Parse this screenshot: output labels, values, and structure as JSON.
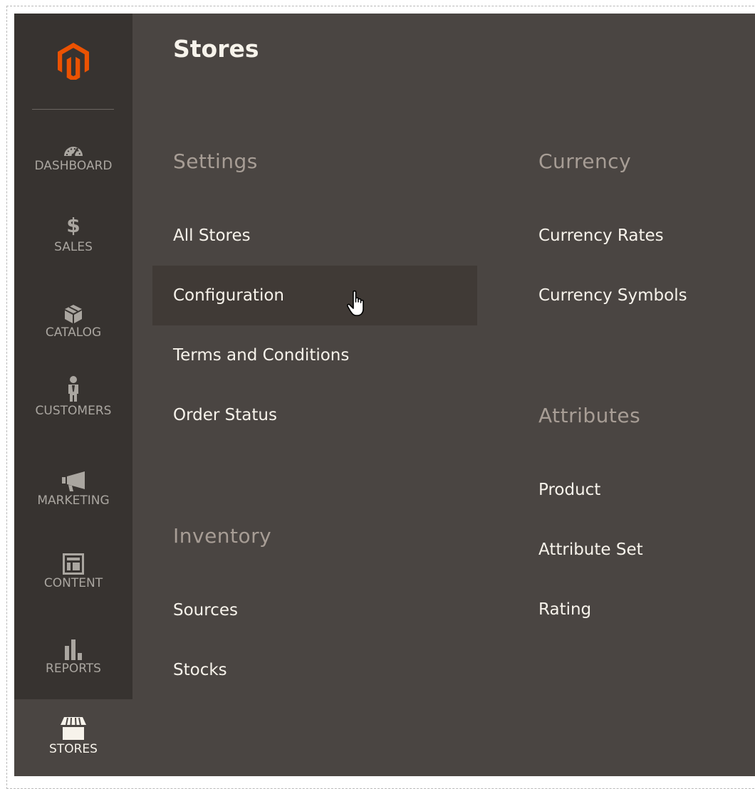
{
  "sidebar": {
    "logo": "magento-logo",
    "items": [
      {
        "label": "DASHBOARD",
        "icon": "dashboard-gauge-icon"
      },
      {
        "label": "SALES",
        "icon": "dollar-icon",
        "glyph": "$"
      },
      {
        "label": "CATALOG",
        "icon": "box-icon"
      },
      {
        "label": "CUSTOMERS",
        "icon": "person-icon"
      },
      {
        "label": "MARKETING",
        "icon": "megaphone-icon"
      },
      {
        "label": "CONTENT",
        "icon": "layout-icon"
      },
      {
        "label": "REPORTS",
        "icon": "bar-chart-icon"
      },
      {
        "label": "STORES",
        "icon": "storefront-icon",
        "active": true
      }
    ]
  },
  "panel": {
    "title": "Stores",
    "settings": {
      "title": "Settings",
      "links": [
        "All Stores",
        "Configuration",
        "Terms and Conditions",
        "Order Status"
      ]
    },
    "inventory": {
      "title": "Inventory",
      "links": [
        "Sources",
        "Stocks"
      ]
    },
    "currency": {
      "title": "Currency",
      "links": [
        "Currency Rates",
        "Currency Symbols"
      ]
    },
    "attributes": {
      "title": "Attributes",
      "links": [
        "Product",
        "Attribute Set",
        "Rating"
      ]
    },
    "hovered_link": "Configuration"
  },
  "colors": {
    "sidebar_bg": "#373330",
    "panel_bg": "#4a4542",
    "hover_bg": "#403a36",
    "accent": "#eb5202",
    "text": "#f7f3eb",
    "section_text": "#a79d95"
  }
}
